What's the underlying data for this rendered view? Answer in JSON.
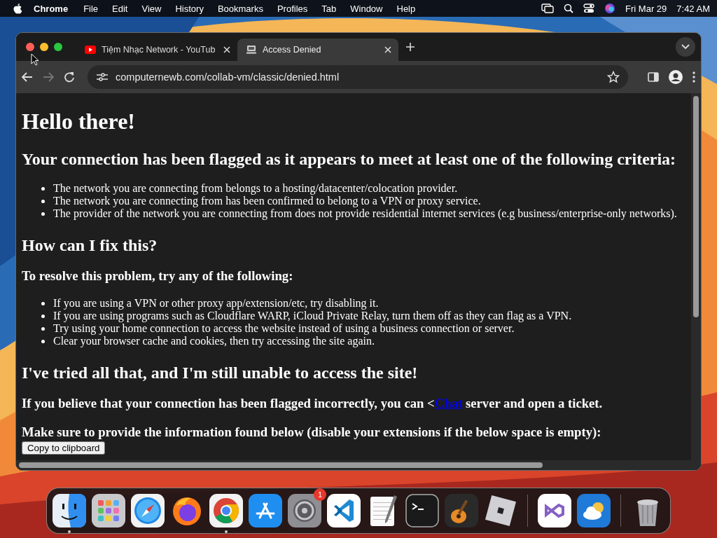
{
  "menu_bar": {
    "app_name": "Chrome",
    "menus": [
      "File",
      "Edit",
      "View",
      "History",
      "Bookmarks",
      "Profiles",
      "Tab",
      "Window",
      "Help"
    ],
    "date": "Fri Mar 29",
    "time": "7:42 AM"
  },
  "browser": {
    "tabs": [
      {
        "title": "Tiệm Nhạc Network - YouTub",
        "kind": "youtube",
        "selected": false
      },
      {
        "title": "Access Denied",
        "kind": "site",
        "selected": true
      }
    ],
    "forward_disabled": true,
    "url": "computernewb.com/collab-vm/classic/denied.html"
  },
  "page": {
    "blocks": [
      {
        "kind": "h1",
        "text": "Hello there!"
      },
      {
        "kind": "h2",
        "text": "Your connection has been flagged as it appears to meet at least one of the following criteria:"
      },
      {
        "kind": "list",
        "items": [
          "The network you are connecting from belongs to a hosting/datacenter/colocation provider.",
          "The network you are connecting from has been confirmed to belong to a VPN or proxy service.",
          "The provider of the network you are connecting from does not provide residential internet services (e.g business/enterprise-only networks)."
        ]
      },
      {
        "kind": "h2",
        "text": "How can I fix this?"
      },
      {
        "kind": "h3",
        "text": "To resolve this problem, try any of the following:"
      },
      {
        "kind": "list",
        "items": [
          "If you are using a VPN or other proxy app/extension/etc, try disabling it.",
          "If you are using programs such as Cloudflare WARP, iCloud Private Relay, turn them off as they can flag as a VPN.",
          "Try using your home connection to access the website instead of using a business connection or server.",
          "Clear your browser cache and cookies, then try accessing the site again."
        ]
      },
      {
        "kind": "h2",
        "text": "I've tried all that, and I'm still unable to access the site!"
      },
      {
        "kind": "h3_link",
        "before": "If you believe that your connection has been flagged incorrectly, you can <",
        "link": "Chat",
        "after": " server and open a ticket."
      },
      {
        "kind": "h3",
        "text": "Make sure to provide the information found below (disable your extensions if the below space is empty):"
      },
      {
        "kind": "button",
        "text": "Copy to clipboard"
      }
    ]
  },
  "dock": {
    "items": [
      {
        "kind": "finder",
        "running": true
      },
      {
        "kind": "launchpad",
        "running": false
      },
      {
        "kind": "safari",
        "running": false
      },
      {
        "kind": "firefox",
        "running": false
      },
      {
        "kind": "chrome",
        "running": true
      },
      {
        "kind": "appstore",
        "running": false
      },
      {
        "kind": "settings",
        "running": false,
        "badge": "1"
      },
      {
        "kind": "vscode",
        "running": false
      },
      {
        "kind": "textedit",
        "running": false
      },
      {
        "kind": "terminal",
        "running": false
      },
      {
        "kind": "guitar",
        "running": false
      },
      {
        "kind": "roblox",
        "running": false
      },
      {
        "kind": "separator"
      },
      {
        "kind": "visualstudio",
        "running": false
      },
      {
        "kind": "weather",
        "running": false
      },
      {
        "kind": "separator"
      },
      {
        "kind": "trash",
        "running": false
      }
    ]
  }
}
